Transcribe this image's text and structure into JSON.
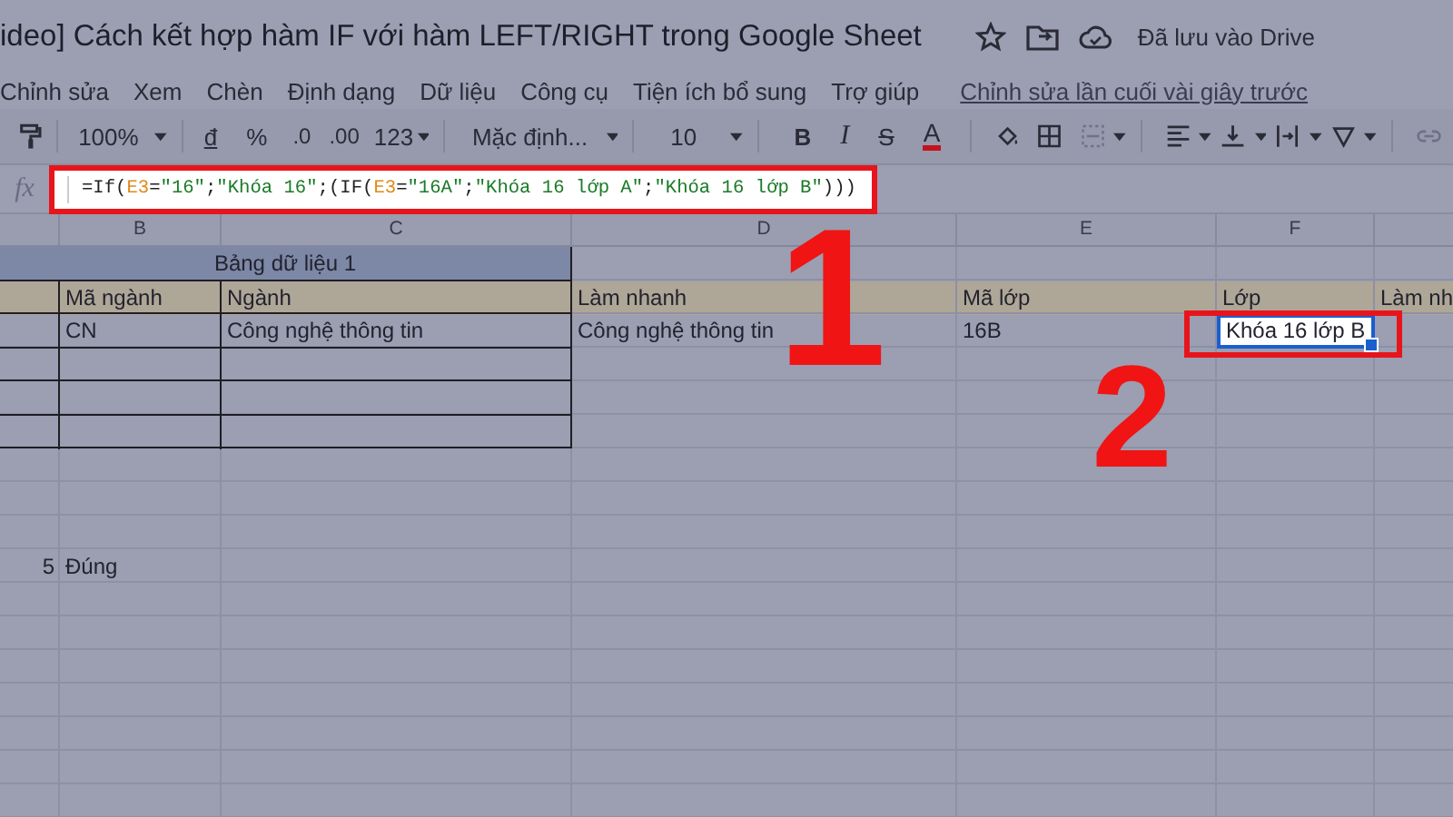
{
  "title_bar": {
    "title": "ideo] Cách kết hợp hàm IF với hàm LEFT/RIGHT trong Google Sheet",
    "save_status": "Đã lưu vào Drive"
  },
  "menu": {
    "items": [
      "Chỉnh sửa",
      "Xem",
      "Chèn",
      "Định dạng",
      "Dữ liệu",
      "Công cụ",
      "Tiện ích bổ sung",
      "Trợ giúp"
    ],
    "last_edit": "Chỉnh sửa lần cuối vài giây trước"
  },
  "toolbar": {
    "zoom": "100%",
    "currency": "đ",
    "percent": "%",
    "decrease_decimal": ".0",
    "increase_decimal": ".00",
    "number_format": "123",
    "font": "Mặc định...",
    "font_size": "10",
    "bold": "B",
    "italic": "I",
    "strikethrough": "S",
    "text_color": "A"
  },
  "formula_bar": {
    "label": "fx",
    "parts": [
      {
        "kind": "plain",
        "text": "=If("
      },
      {
        "kind": "ref",
        "text": "E3"
      },
      {
        "kind": "plain",
        "text": "="
      },
      {
        "kind": "string",
        "text": "\"16\""
      },
      {
        "kind": "plain",
        "text": ";"
      },
      {
        "kind": "string",
        "text": "\"Khóa 16\""
      },
      {
        "kind": "plain",
        "text": ";(IF("
      },
      {
        "kind": "ref",
        "text": "E3"
      },
      {
        "kind": "plain",
        "text": "="
      },
      {
        "kind": "string",
        "text": "\"16A\""
      },
      {
        "kind": "plain",
        "text": ";"
      },
      {
        "kind": "string",
        "text": "\"Khóa 16 lớp A\""
      },
      {
        "kind": "plain",
        "text": ";"
      },
      {
        "kind": "string",
        "text": "\"Khóa 16 lớp B\""
      },
      {
        "kind": "plain",
        "text": ")))"
      }
    ]
  },
  "sheet": {
    "columns": [
      "B",
      "C",
      "D",
      "E",
      "F"
    ],
    "cells": {
      "A1": {
        "kind": "title",
        "text": "Bảng dữ liệu 1",
        "selected": false
      },
      "B2": {
        "kind": "header",
        "text": "Mã ngành",
        "selected": false
      },
      "C2": {
        "kind": "header",
        "text": "Ngành",
        "selected": false
      },
      "D2": {
        "kind": "header",
        "text": "Làm nhanh",
        "selected": false
      },
      "E2": {
        "kind": "header",
        "text": "Mã lớp",
        "selected": false
      },
      "F2": {
        "kind": "header",
        "text": "Lớp",
        "selected": false
      },
      "G2": {
        "kind": "header",
        "text": "Làm nh",
        "selected": false
      },
      "B3": {
        "kind": "value",
        "text": "CN",
        "selected": false
      },
      "C3": {
        "kind": "value",
        "text": "Công nghệ thông tin",
        "selected": false
      },
      "D3": {
        "kind": "value",
        "text": "Công nghệ thông tin",
        "selected": false
      },
      "E3": {
        "kind": "value",
        "text": "16B",
        "selected": false
      },
      "F3": {
        "kind": "value",
        "text": "Khóa 16 lớp B",
        "selected": true
      },
      "A10": {
        "kind": "number",
        "text": "5",
        "selected": false
      },
      "B10": {
        "kind": "value",
        "text": "Đúng",
        "selected": false
      }
    }
  },
  "annotations": [
    {
      "text": "1"
    },
    {
      "text": "2"
    }
  ]
}
